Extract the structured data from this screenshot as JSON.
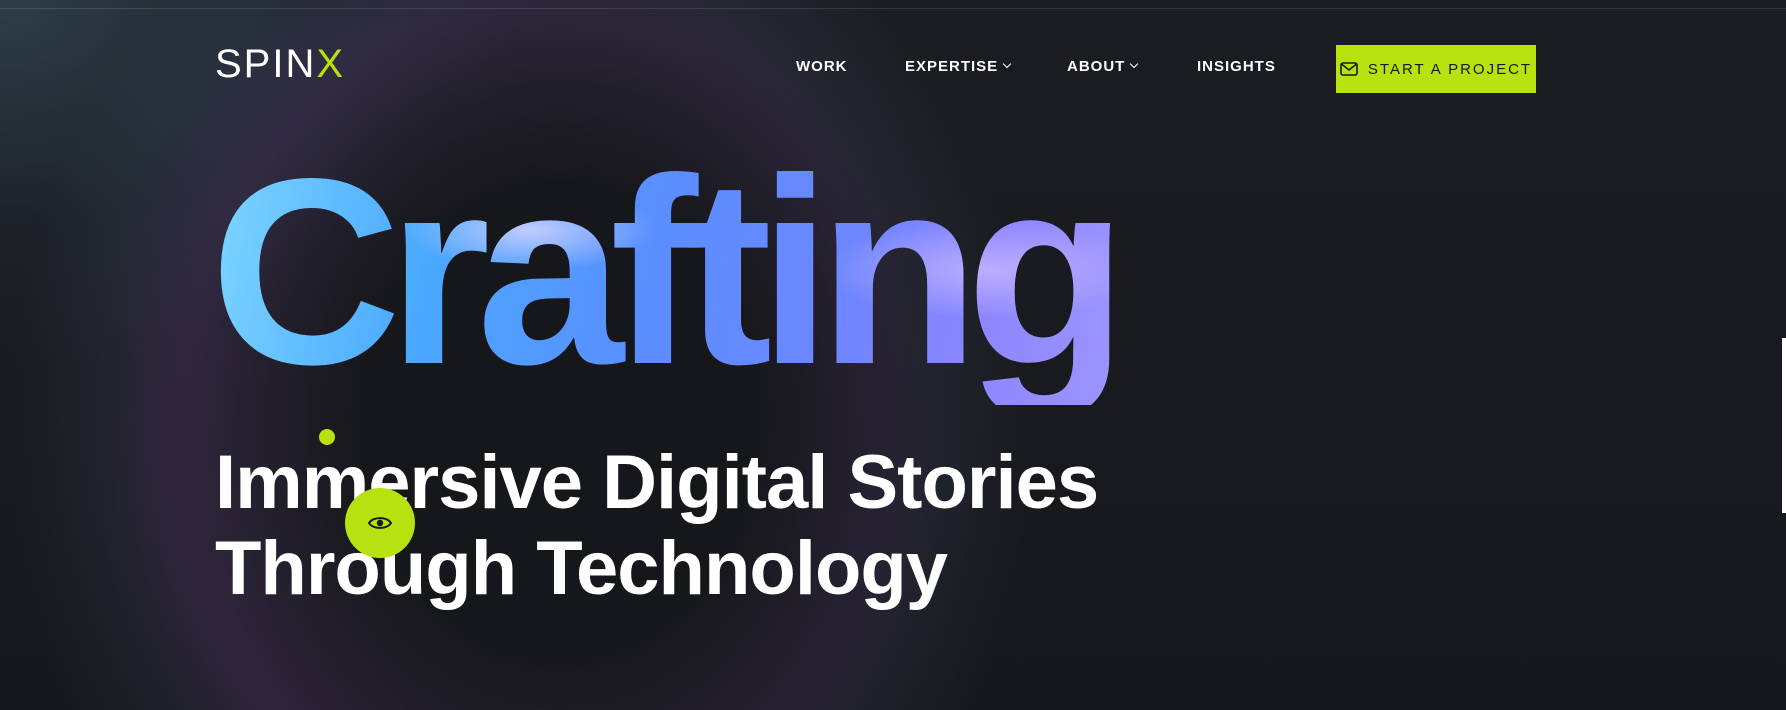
{
  "header": {
    "logo_text": "SPIN",
    "logo_accent": "X",
    "nav": [
      {
        "label": "WORK",
        "has_dropdown": false
      },
      {
        "label": "EXPERTISE",
        "has_dropdown": true
      },
      {
        "label": "ABOUT",
        "has_dropdown": true
      },
      {
        "label": "INSIGHTS",
        "has_dropdown": false
      }
    ],
    "cta": {
      "label": "START A PROJECT",
      "icon": "mail-icon"
    }
  },
  "hero": {
    "title": "Crafting",
    "subtitle_line1": "Immersive Digital Stories",
    "subtitle_line2": "Through Technology",
    "view_button_icon": "eye-icon"
  },
  "colors": {
    "accent": "#b7e10f",
    "background": "#16171b",
    "text": "#ffffff"
  }
}
